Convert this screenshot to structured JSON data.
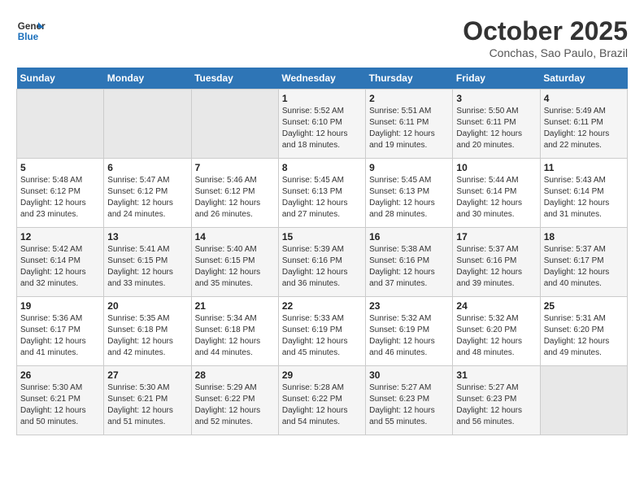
{
  "header": {
    "logo_line1": "General",
    "logo_line2": "Blue",
    "month_title": "October 2025",
    "location": "Conchas, Sao Paulo, Brazil"
  },
  "weekdays": [
    "Sunday",
    "Monday",
    "Tuesday",
    "Wednesday",
    "Thursday",
    "Friday",
    "Saturday"
  ],
  "weeks": [
    [
      {
        "day": "",
        "empty": true
      },
      {
        "day": "",
        "empty": true
      },
      {
        "day": "",
        "empty": true
      },
      {
        "day": "1",
        "sunrise": "5:52 AM",
        "sunset": "6:10 PM",
        "daylight": "12 hours and 18 minutes."
      },
      {
        "day": "2",
        "sunrise": "5:51 AM",
        "sunset": "6:11 PM",
        "daylight": "12 hours and 19 minutes."
      },
      {
        "day": "3",
        "sunrise": "5:50 AM",
        "sunset": "6:11 PM",
        "daylight": "12 hours and 20 minutes."
      },
      {
        "day": "4",
        "sunrise": "5:49 AM",
        "sunset": "6:11 PM",
        "daylight": "12 hours and 22 minutes."
      }
    ],
    [
      {
        "day": "5",
        "sunrise": "5:48 AM",
        "sunset": "6:12 PM",
        "daylight": "12 hours and 23 minutes."
      },
      {
        "day": "6",
        "sunrise": "5:47 AM",
        "sunset": "6:12 PM",
        "daylight": "12 hours and 24 minutes."
      },
      {
        "day": "7",
        "sunrise": "5:46 AM",
        "sunset": "6:12 PM",
        "daylight": "12 hours and 26 minutes."
      },
      {
        "day": "8",
        "sunrise": "5:45 AM",
        "sunset": "6:13 PM",
        "daylight": "12 hours and 27 minutes."
      },
      {
        "day": "9",
        "sunrise": "5:45 AM",
        "sunset": "6:13 PM",
        "daylight": "12 hours and 28 minutes."
      },
      {
        "day": "10",
        "sunrise": "5:44 AM",
        "sunset": "6:14 PM",
        "daylight": "12 hours and 30 minutes."
      },
      {
        "day": "11",
        "sunrise": "5:43 AM",
        "sunset": "6:14 PM",
        "daylight": "12 hours and 31 minutes."
      }
    ],
    [
      {
        "day": "12",
        "sunrise": "5:42 AM",
        "sunset": "6:14 PM",
        "daylight": "12 hours and 32 minutes."
      },
      {
        "day": "13",
        "sunrise": "5:41 AM",
        "sunset": "6:15 PM",
        "daylight": "12 hours and 33 minutes."
      },
      {
        "day": "14",
        "sunrise": "5:40 AM",
        "sunset": "6:15 PM",
        "daylight": "12 hours and 35 minutes."
      },
      {
        "day": "15",
        "sunrise": "5:39 AM",
        "sunset": "6:16 PM",
        "daylight": "12 hours and 36 minutes."
      },
      {
        "day": "16",
        "sunrise": "5:38 AM",
        "sunset": "6:16 PM",
        "daylight": "12 hours and 37 minutes."
      },
      {
        "day": "17",
        "sunrise": "5:37 AM",
        "sunset": "6:16 PM",
        "daylight": "12 hours and 39 minutes."
      },
      {
        "day": "18",
        "sunrise": "5:37 AM",
        "sunset": "6:17 PM",
        "daylight": "12 hours and 40 minutes."
      }
    ],
    [
      {
        "day": "19",
        "sunrise": "5:36 AM",
        "sunset": "6:17 PM",
        "daylight": "12 hours and 41 minutes."
      },
      {
        "day": "20",
        "sunrise": "5:35 AM",
        "sunset": "6:18 PM",
        "daylight": "12 hours and 42 minutes."
      },
      {
        "day": "21",
        "sunrise": "5:34 AM",
        "sunset": "6:18 PM",
        "daylight": "12 hours and 44 minutes."
      },
      {
        "day": "22",
        "sunrise": "5:33 AM",
        "sunset": "6:19 PM",
        "daylight": "12 hours and 45 minutes."
      },
      {
        "day": "23",
        "sunrise": "5:32 AM",
        "sunset": "6:19 PM",
        "daylight": "12 hours and 46 minutes."
      },
      {
        "day": "24",
        "sunrise": "5:32 AM",
        "sunset": "6:20 PM",
        "daylight": "12 hours and 48 minutes."
      },
      {
        "day": "25",
        "sunrise": "5:31 AM",
        "sunset": "6:20 PM",
        "daylight": "12 hours and 49 minutes."
      }
    ],
    [
      {
        "day": "26",
        "sunrise": "5:30 AM",
        "sunset": "6:21 PM",
        "daylight": "12 hours and 50 minutes."
      },
      {
        "day": "27",
        "sunrise": "5:30 AM",
        "sunset": "6:21 PM",
        "daylight": "12 hours and 51 minutes."
      },
      {
        "day": "28",
        "sunrise": "5:29 AM",
        "sunset": "6:22 PM",
        "daylight": "12 hours and 52 minutes."
      },
      {
        "day": "29",
        "sunrise": "5:28 AM",
        "sunset": "6:22 PM",
        "daylight": "12 hours and 54 minutes."
      },
      {
        "day": "30",
        "sunrise": "5:27 AM",
        "sunset": "6:23 PM",
        "daylight": "12 hours and 55 minutes."
      },
      {
        "day": "31",
        "sunrise": "5:27 AM",
        "sunset": "6:23 PM",
        "daylight": "12 hours and 56 minutes."
      },
      {
        "day": "",
        "empty": true
      }
    ]
  ]
}
